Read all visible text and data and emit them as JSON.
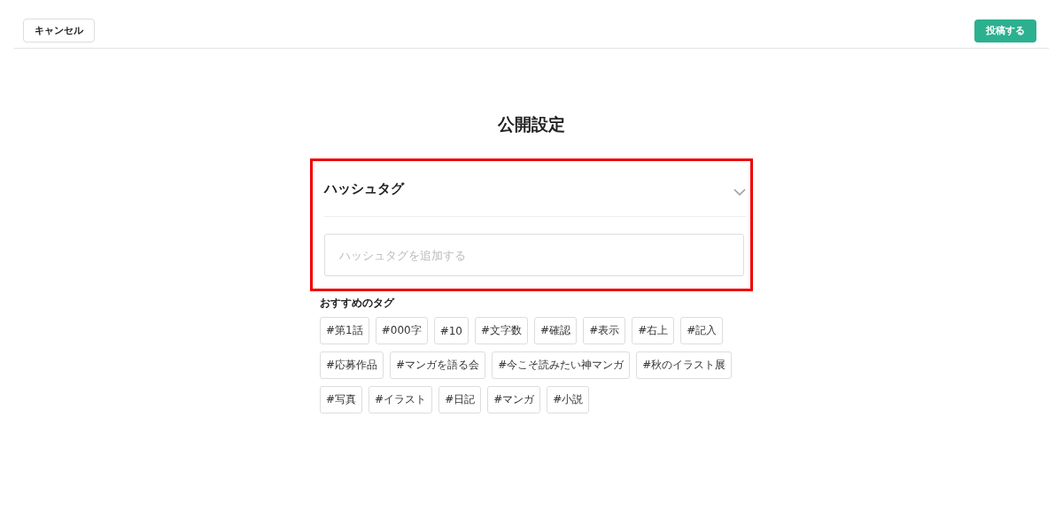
{
  "header": {
    "cancel_button": "キャンセル",
    "post_button": "投稿する"
  },
  "title": "公開設定",
  "hashtag_section": {
    "heading": "ハッシュタグ",
    "input": {
      "placeholder": "ハッシュタグを追加する"
    }
  },
  "recommended": {
    "heading": "おすすめのタグ",
    "tag_rows": [
      [
        "#第1話",
        "#000字",
        "#10",
        "#文字数",
        "#確認",
        "#表示",
        "#右上",
        "#記入"
      ],
      [
        "#応募作品",
        "#マンガを語る会",
        "#今こそ読みたい神マンガ",
        "#秋のイラスト展"
      ],
      [
        "#写真",
        "#イラスト",
        "#日記",
        "#マンガ",
        "#小説"
      ]
    ]
  }
}
